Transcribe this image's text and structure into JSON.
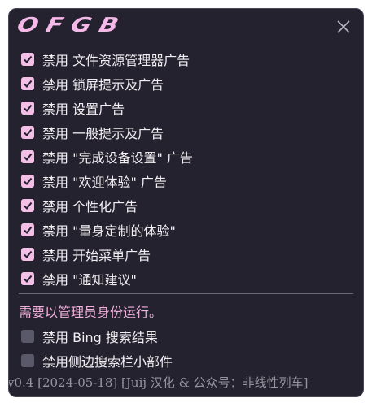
{
  "app": {
    "title": "OFGB",
    "accent_color": "#f4bfe6",
    "background_color": "#24222f"
  },
  "window_controls": {
    "close_icon": "close-icon"
  },
  "options": [
    {
      "label": "禁用 文件资源管理器广告",
      "checked": true
    },
    {
      "label": "禁用 锁屏提示及广告",
      "checked": true
    },
    {
      "label": "禁用 设置广告",
      "checked": true
    },
    {
      "label": "禁用 一般提示及广告",
      "checked": true
    },
    {
      "label": "禁用 \"完成设备设置\" 广告",
      "checked": true
    },
    {
      "label": "禁用 \"欢迎体验\" 广告",
      "checked": true
    },
    {
      "label": "禁用 个性化广告",
      "checked": true
    },
    {
      "label": "禁用 \"量身定制的体验\"",
      "checked": true
    },
    {
      "label": "禁用 开始菜单广告",
      "checked": true
    },
    {
      "label": "禁用 \"通知建议\"",
      "checked": true
    }
  ],
  "admin": {
    "note": "需要以管理员身份运行。",
    "note_color": "#f3b2dd",
    "options": [
      {
        "label": "禁用 Bing 搜索结果",
        "checked": false
      },
      {
        "label": "禁用侧边搜索栏小部件",
        "checked": false
      }
    ]
  },
  "footer": {
    "version_text": "v0.4 [2024-05-18] [Juij 汉化 & 公众号：非线性列车]"
  }
}
